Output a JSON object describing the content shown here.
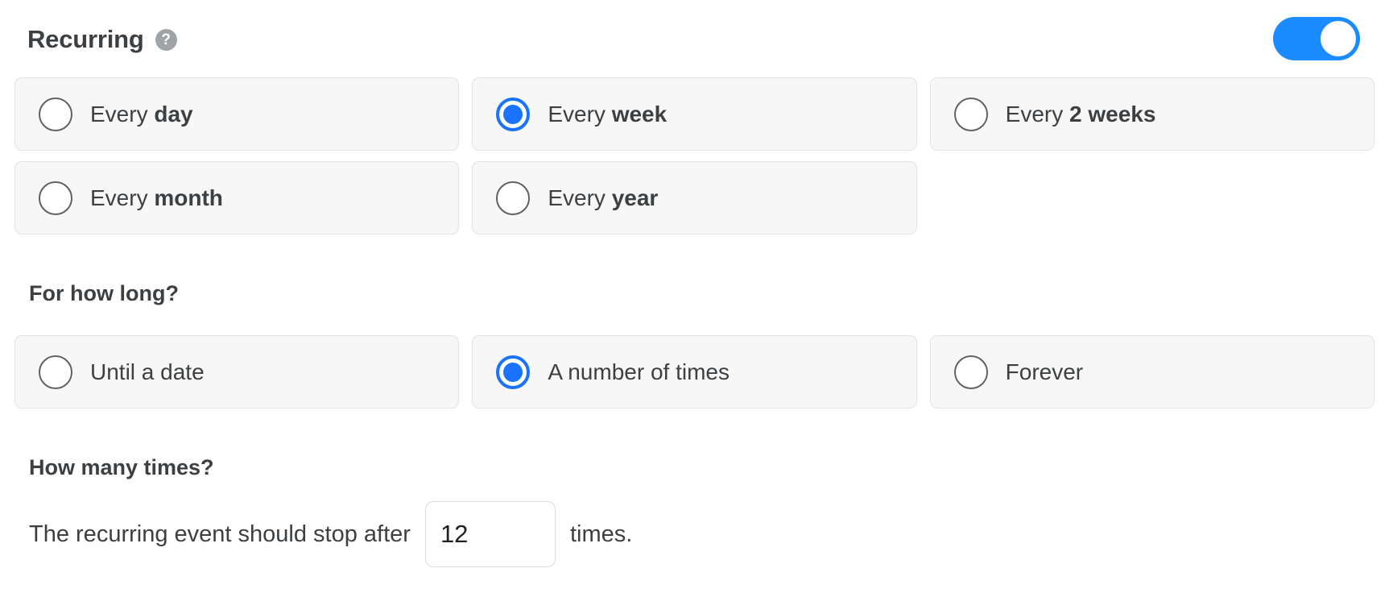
{
  "header": {
    "title": "Recurring",
    "help_icon": "help-circle-icon",
    "help_glyph": "?",
    "toggle": {
      "state": "on",
      "accent_color": "#1a8cff"
    }
  },
  "frequency": {
    "options": [
      {
        "prefix": "Every ",
        "strong": "day",
        "selected": false
      },
      {
        "prefix": "Every ",
        "strong": "week",
        "selected": true
      },
      {
        "prefix": "Every ",
        "strong": "2 weeks",
        "selected": false
      },
      {
        "prefix": "Every ",
        "strong": "month",
        "selected": false
      },
      {
        "prefix": "Every ",
        "strong": "year",
        "selected": false
      }
    ]
  },
  "duration": {
    "heading": "For how long?",
    "options": [
      {
        "prefix": "Until a date",
        "strong": "",
        "selected": false
      },
      {
        "prefix": "A number of times",
        "strong": "",
        "selected": true
      },
      {
        "prefix": "Forever",
        "strong": "",
        "selected": false
      }
    ]
  },
  "count": {
    "heading": "How many times?",
    "sentence_before": "The recurring event should stop after",
    "value": "12",
    "placeholder": "",
    "sentence_after": "times."
  },
  "colors": {
    "accent": "#1a73ff",
    "toggle_on": "#1a8cff",
    "text": "#3c4043",
    "card_bg": "#f7f7f7",
    "card_border": "#e3e3e3"
  }
}
